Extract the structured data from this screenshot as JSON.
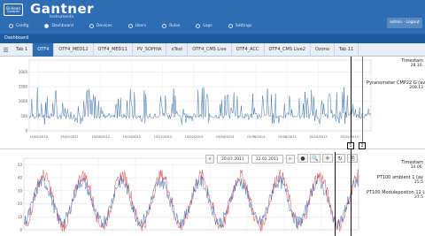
{
  "header": {
    "logo_badge": "Bi-Head",
    "logo_sub": "Gantner",
    "brand": "Gantner",
    "brand_sub": "Instruments",
    "user_button": "admin · Logout",
    "nav": [
      {
        "label": "Config",
        "active": false
      },
      {
        "label": "Dashboard",
        "active": true
      },
      {
        "label": "Devices",
        "active": false
      },
      {
        "label": "Users",
        "active": false
      },
      {
        "label": "Rules",
        "active": false
      },
      {
        "label": "Logs",
        "active": false
      },
      {
        "label": "Settings",
        "active": false
      }
    ]
  },
  "dashboard": {
    "title": "Dashboard"
  },
  "tabs": [
    {
      "label": "Tab 1",
      "active": false
    },
    {
      "label": "OTF4",
      "active": true
    },
    {
      "label": "OTF4_MED12",
      "active": false
    },
    {
      "label": "OTF4_MED11",
      "active": false
    },
    {
      "label": "PV_SOPHIA",
      "active": false
    },
    {
      "label": "xTest",
      "active": false
    },
    {
      "label": "OTF4_CMS Live",
      "active": false
    },
    {
      "label": "OTF4_ACC",
      "active": false
    },
    {
      "label": "OTF4_CMS Live2",
      "active": false
    },
    {
      "label": "Ozono",
      "active": false
    },
    {
      "label": "Tab 11",
      "active": false
    }
  ],
  "top_panel": {
    "timestamp_label": "Timestam",
    "timestamp_value": "28.10.",
    "channel_label": "Pyranometer CMP22 G (av",
    "channel_value": "208.13",
    "cursors": [
      "1",
      "2"
    ]
  },
  "bottom_panel": {
    "prev_icon": "chevron-double-left-icon",
    "next_icon": "chevron-double-right-icon",
    "date_from": "20.07.2011",
    "date_to": "12.02.2011",
    "tools": [
      "●",
      "🔍",
      "✛",
      "↻",
      "🗎"
    ],
    "timestamp_label": "Timestam",
    "timestamp_value": "14.06.",
    "channel1_label": "PT100 ambient 1 (av",
    "channel1_value": "25.5",
    "channel2_label": "PT100 Modulepostion 12 (av",
    "channel2_value": "27.5"
  },
  "chart_data": [
    {
      "type": "line",
      "title": "",
      "xlabel": "",
      "ylabel": "",
      "x_ticks": [
        "15/05/2010",
        "15/05/2011",
        "15/08/2012",
        "15/10/2012",
        "15/12/2012",
        "15/02/2013",
        "15/04/2013",
        "15/06/2013",
        "15/08/2013",
        "15/10/2013",
        "15/12/2013"
      ],
      "y_ticks": [
        0,
        500,
        1000,
        1500,
        2000
      ],
      "ylim": [
        0,
        2400
      ],
      "series": [
        {
          "name": "Pyranometer CMP22 G (av",
          "color": "#3a6fa8",
          "baseline": 500,
          "peak_max": 1500
        }
      ]
    },
    {
      "type": "line",
      "title": "",
      "xlabel": "",
      "ylabel": "",
      "y_ticks": [
        0,
        10,
        20,
        30,
        40,
        50
      ],
      "ylim": [
        0,
        55
      ],
      "series": [
        {
          "name": "PT100 ambient 1 (av",
          "color": "#d83a3a",
          "cycles": 8.5,
          "min": 0,
          "max": 45
        },
        {
          "name": "PT100 Modulepostion 12 (av",
          "color": "#2e5fb0",
          "cycles": 8.5,
          "min": 3,
          "max": 40
        }
      ]
    }
  ]
}
